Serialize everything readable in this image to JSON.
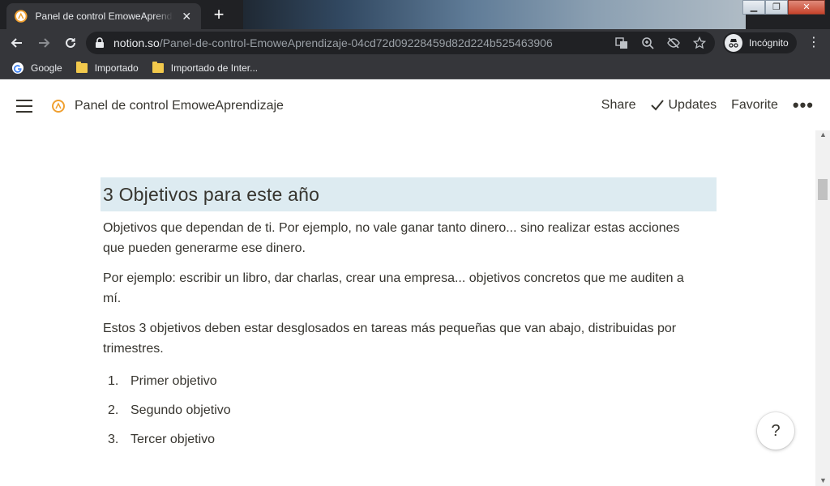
{
  "browser": {
    "tab_title": "Panel de control EmoweAprendizaje",
    "new_tab_label": "+",
    "close_tab_label": "✕",
    "window_controls": {
      "minimize": "▁",
      "maximize": "❐",
      "close": "✕"
    },
    "url_host": "notion.so",
    "url_path": "/Panel-de-control-EmoweAprendizaje-04cd72d09228459d82d224b525463906",
    "incognito_label": "Incógnito",
    "bookmarks": [
      {
        "label": "Google",
        "icon": "google-icon"
      },
      {
        "label": "Importado",
        "icon": "folder-icon"
      },
      {
        "label": "Importado de Inter...",
        "icon": "folder-icon"
      }
    ]
  },
  "notion": {
    "page_title": "Panel de control EmoweAprendizaje",
    "actions": {
      "share": "Share",
      "updates": "Updates",
      "favorite": "Favorite",
      "more": "•••"
    },
    "heading": "3 Objetivos para este año",
    "paragraphs": [
      "Objetivos que dependan de ti. Por ejemplo, no vale ganar tanto dinero... sino realizar estas acciones que pueden generarme ese dinero.",
      "Por ejemplo: escribir un libro, dar charlas, crear una empresa... objetivos concretos que me auditen a mí.",
      "Estos 3 objetivos deben estar desglosados en tareas más pequeñas que van abajo, distribuidas por trimestres."
    ],
    "list": [
      {
        "num": "1.",
        "text": "Primer objetivo"
      },
      {
        "num": "2.",
        "text": "Segundo objetivo"
      },
      {
        "num": "3.",
        "text": "Tercer objetivo"
      }
    ],
    "help_label": "?",
    "heading_bg": "#ddebf1"
  }
}
